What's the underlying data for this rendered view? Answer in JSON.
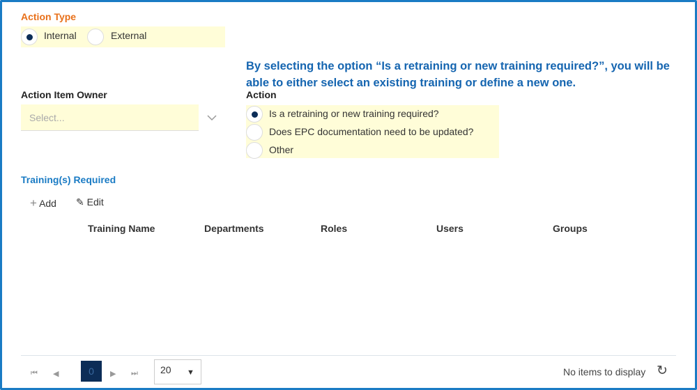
{
  "action_type": {
    "label": "Action Type",
    "options": [
      "Internal",
      "External"
    ],
    "selected": 0
  },
  "owner": {
    "label": "Action Item Owner",
    "placeholder": "Select..."
  },
  "info_text": "By selecting the option “Is a retraining or new training required?”, you will be able to either select an existing training or define a new one.",
  "action": {
    "label": "Action",
    "options": [
      "Is a retraining or new training required?",
      "Does EPC documentation need to be updated?",
      "Other"
    ],
    "selected": 0
  },
  "trainings": {
    "label": "Training(s) Required",
    "add": "Add",
    "edit": "Edit",
    "columns": [
      "Training Name",
      "Departments",
      "Roles",
      "Users",
      "Groups"
    ]
  },
  "pager": {
    "page": "0",
    "page_size": "20",
    "status": "No items to display"
  }
}
